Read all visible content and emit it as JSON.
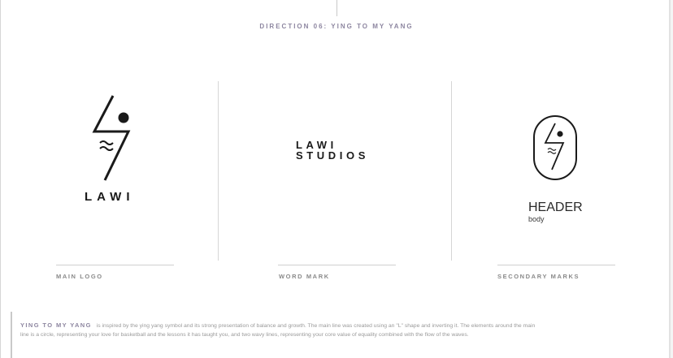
{
  "header": {
    "title": "DIRECTION 06: YING TO MY YANG"
  },
  "sections": [
    {
      "label": "MAIN LOGO",
      "brand": "LAWI",
      "icon": "lightning-bolt-ball-icon"
    },
    {
      "label": "WORD MARK",
      "line1": "LAWI",
      "line2": "STUDIOS"
    },
    {
      "label": "SECONDARY MARKS",
      "type_header": "HEADER",
      "type_body": "body",
      "icon": "oval-badge-icon"
    }
  ],
  "description": {
    "lead": "YING TO MY YANG",
    "text": "is inspired by the ying yang symbol and its strong presentation of balance and growth. The main line was created using an \"L\" shape and inverting it. The elements around the main line is a circle, representing your love for basketball and the lessons it has taught you, and two wavy lines, representing your core value of equality combined with the flow of the waves."
  },
  "colors": {
    "accent": "#8d86a0",
    "ink": "#1a1a1a",
    "muted": "#9a9a9a"
  }
}
